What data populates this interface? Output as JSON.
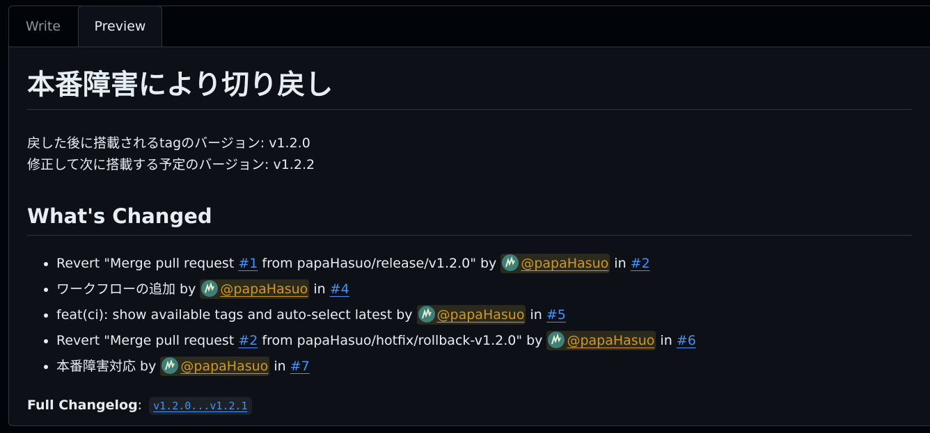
{
  "tabs": {
    "write": "Write",
    "preview": "Preview"
  },
  "content": {
    "title": "本番障害により切り戻し",
    "paragraph": {
      "line1": "戻した後に搭載されるtagのバージョン: v1.2.0",
      "line2": "修正して次に搭載する予定のバージョン: v1.2.2"
    },
    "section_heading": "What's Changed",
    "items": [
      {
        "before": "Revert \"Merge pull request ",
        "ref": "#1",
        "after": " from papaHasuo/release/v1.2.0\" by ",
        "user": "@papaHasuo",
        "in": " in ",
        "pr": "#2"
      },
      {
        "before": "ワークフローの追加 by ",
        "user": "@papaHasuo",
        "in": " in ",
        "pr": "#4"
      },
      {
        "before": "feat(ci): show available tags and auto-select latest by ",
        "user": "@papaHasuo",
        "in": " in ",
        "pr": "#5"
      },
      {
        "before": "Revert \"Merge pull request ",
        "ref": "#2",
        "after": " from papaHasuo/hotfix/rollback-v1.2.0\" by ",
        "user": "@papaHasuo",
        "in": " in ",
        "pr": "#6"
      },
      {
        "before": "本番障害対応 by ",
        "user": "@papaHasuo",
        "in": " in ",
        "pr": "#7"
      }
    ],
    "changelog": {
      "label": "Full Changelog",
      "colon": ": ",
      "compare": "v1.2.0...v1.2.1"
    }
  },
  "colors": {
    "link": "#4493f8",
    "mention": "#d29922",
    "background": "#0d1117",
    "text": "#e6edf3"
  }
}
